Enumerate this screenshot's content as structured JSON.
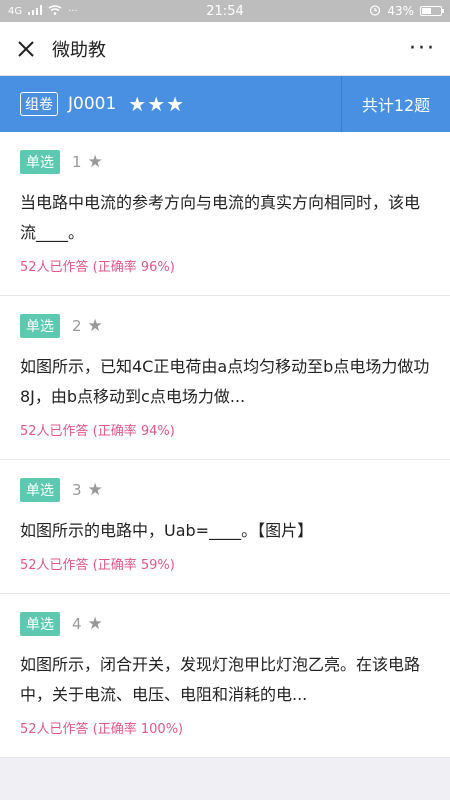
{
  "statusbar": {
    "network": "4G",
    "dots": "···",
    "time": "21:54",
    "battery_pct": "43%",
    "battery_level": 0.43
  },
  "header": {
    "title": "微助教",
    "more_label": "···"
  },
  "banner": {
    "tag": "组卷",
    "code": "J0001",
    "stars": "★★★",
    "total": "共计12题"
  },
  "questions": [
    {
      "type": "单选",
      "num": "1",
      "star": "★",
      "text": "当电路中电流的参考方向与电流的真实方向相同时，该电流____。",
      "meta": "52人已作答 (正确率 96%)"
    },
    {
      "type": "单选",
      "num": "2",
      "star": "★",
      "text": "如图所示，已知4C正电荷由a点均匀移动至b点电场力做功8J，由b点移动到c点电场力做...",
      "meta": "52人已作答 (正确率 94%)"
    },
    {
      "type": "单选",
      "num": "3",
      "star": "★",
      "text": "如图所示的电路中，Uab=____。【图片】",
      "meta": "52人已作答 (正确率 59%)"
    },
    {
      "type": "单选",
      "num": "4",
      "star": "★",
      "text": "如图所示，闭合开关，发现灯泡甲比灯泡乙亮。在该电路中，关于电流、电压、电阻和消耗的电...",
      "meta": "52人已作答 (正确率 100%)"
    }
  ]
}
